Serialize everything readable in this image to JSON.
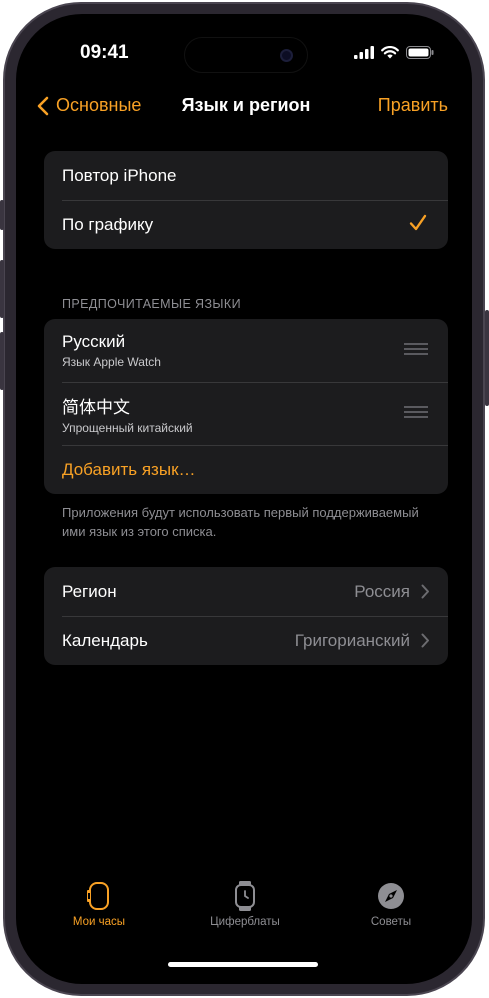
{
  "status": {
    "time": "09:41"
  },
  "nav": {
    "back_label": "Основные",
    "title": "Язык и регион",
    "edit_label": "Править"
  },
  "mode_group": {
    "items": [
      {
        "label": "Повтор iPhone"
      },
      {
        "label": "По графику",
        "selected": true
      }
    ]
  },
  "languages": {
    "header": "ПРЕДПОЧИТАЕМЫЕ ЯЗЫКИ",
    "items": [
      {
        "name": "Русский",
        "subtitle": "Язык Apple Watch"
      },
      {
        "name": "简体中文",
        "subtitle": "Упрощенный китайский"
      }
    ],
    "add_label": "Добавить язык…",
    "footnote": "Приложения будут использовать первый поддерживаемый ими язык из этого списка."
  },
  "settings": {
    "items": [
      {
        "label": "Регион",
        "value": "Россия"
      },
      {
        "label": "Календарь",
        "value": "Григорианский"
      }
    ]
  },
  "tabs": [
    {
      "label": "Мои часы",
      "icon": "watch-icon",
      "active": true
    },
    {
      "label": "Циферблаты",
      "icon": "watch-face-icon",
      "active": false
    },
    {
      "label": "Советы",
      "icon": "compass-icon",
      "active": false
    }
  ],
  "colors": {
    "accent": "#f8a125",
    "background": "#000000",
    "cell": "#1c1c1e",
    "secondary_text": "#8e8e93"
  }
}
